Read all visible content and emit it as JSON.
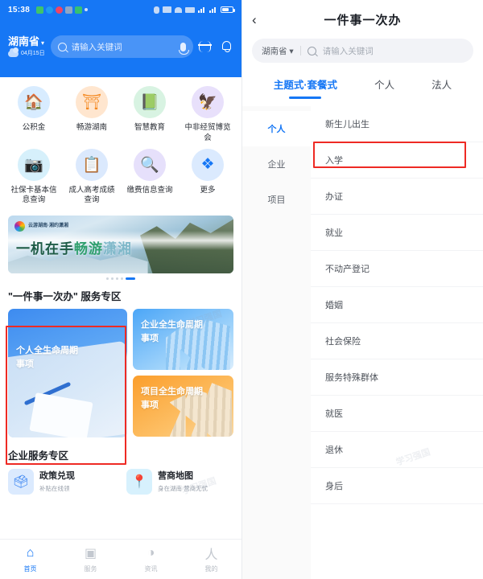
{
  "left": {
    "statusbar": {
      "time": "15:38",
      "icons": [
        "wechat-icon",
        "camera-icon",
        "app-icon",
        "alipay-icon",
        "mail-icon",
        "dot-icon"
      ],
      "right_icons": [
        "person-icon",
        "network-icon",
        "wifi-icon",
        "sim-icon",
        "signal-icon",
        "signal2-icon",
        "battery-icon"
      ]
    },
    "header": {
      "city": "湖南省",
      "caret": "▾",
      "weather": "04月15日",
      "search_placeholder": "请输入关键词",
      "mic": "mic-icon",
      "scan": "scan-icon",
      "bell": "bell-icon"
    },
    "grid": [
      {
        "label": "公积金",
        "glyph": "🏠",
        "bg": "#d8ecff",
        "fg": "#1f8cf5"
      },
      {
        "label": "畅游湖南",
        "glyph": "⛩",
        "bg": "#ffe6cf",
        "fg": "#f58a22"
      },
      {
        "label": "智慧教育",
        "glyph": "📗",
        "bg": "#d8f3e2",
        "fg": "#2bb463"
      },
      {
        "label": "中非经贸博览会",
        "glyph": "🦅",
        "bg": "#e8e0fb",
        "fg": "#8b5cf0"
      },
      {
        "label": "社保卡基本信息查询",
        "glyph": "📷",
        "bg": "#d6f0fb",
        "fg": "#17b6e0"
      },
      {
        "label": "成人高考成绩查询",
        "glyph": "📋",
        "bg": "#dbe9fd",
        "fg": "#2e7df0"
      },
      {
        "label": "缴费信息查询",
        "glyph": "🔍",
        "bg": "#e6e0fb",
        "fg": "#7b3ff0"
      },
      {
        "label": "更多",
        "glyph": "❖",
        "bg": "#dbeafe",
        "fg": "#1677f5"
      }
    ],
    "banner": {
      "logo_text": "云游湖南·湘约潇湘",
      "headline_a": "一机在手",
      "headline_b": "畅游",
      "headline_c": "潇湘",
      "dots": 5,
      "active_dot": 5
    },
    "section": {
      "title": "\"一件事一次办\" 服务专区"
    },
    "cards": [
      {
        "name": "个人全生命周期事项",
        "line1": "个人全生命周期",
        "line2": "事项"
      },
      {
        "name": "企业全生命周期事项",
        "line1": "企业全生命周期",
        "line2": "事项"
      },
      {
        "name": "项目全生命周期事项",
        "line1": "项目全生命周期",
        "line2": "事项"
      }
    ],
    "enterprise": {
      "title": "企业服务专区",
      "items": [
        {
          "title": "政策兑现",
          "sub": "补贴在线领",
          "glyph": "🗳",
          "bg": "#dbeafe",
          "fg": "#2e7df0"
        },
        {
          "title": "营商地图",
          "sub": "身在湖南 营商无忧",
          "glyph": "📍",
          "bg": "#d7f1fd",
          "fg": "#14a8ea"
        }
      ]
    },
    "tabbar": [
      {
        "label": "首页",
        "glyph": "⌂",
        "active": true
      },
      {
        "label": "服务",
        "glyph": "▣",
        "active": false
      },
      {
        "label": "资讯",
        "glyph": "◑",
        "active": false
      },
      {
        "label": "我的",
        "glyph": "人",
        "active": false
      }
    ]
  },
  "right": {
    "back": "‹",
    "title": "一件事一次办",
    "search": {
      "city": "湖南省",
      "caret": "▾",
      "placeholder": "请输入关键词"
    },
    "tabs": [
      {
        "label": "主题式·套餐式",
        "active": true
      },
      {
        "label": "个人",
        "active": false
      },
      {
        "label": "法人",
        "active": false
      }
    ],
    "side": [
      {
        "label": "个人",
        "active": true
      },
      {
        "label": "企业",
        "active": false
      },
      {
        "label": "项目",
        "active": false
      }
    ],
    "list": [
      {
        "label": "新生儿出生",
        "highlighted": false
      },
      {
        "label": "入学",
        "highlighted": true
      },
      {
        "label": "办证",
        "highlighted": false
      },
      {
        "label": "就业",
        "highlighted": false
      },
      {
        "label": "不动产登记",
        "highlighted": false
      },
      {
        "label": "婚姻",
        "highlighted": false
      },
      {
        "label": "社会保险",
        "highlighted": false
      },
      {
        "label": "服务特殊群体",
        "highlighted": false
      },
      {
        "label": "就医",
        "highlighted": false
      },
      {
        "label": "退休",
        "highlighted": false
      },
      {
        "label": "身后",
        "highlighted": false
      }
    ]
  },
  "annotations": {
    "highlight_color": "#ee2a24"
  },
  "watermarks": [
    "学习强国",
    "学习强国",
    "学习强国"
  ]
}
